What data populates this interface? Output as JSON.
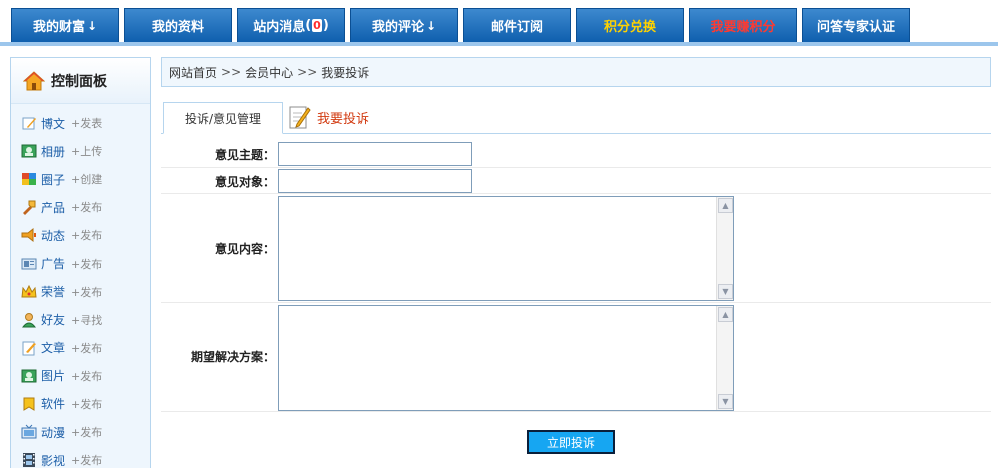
{
  "topnav": {
    "tabs": [
      {
        "label": "我的财富",
        "arrow": "↓",
        "style": "normal"
      },
      {
        "label": "我的资料",
        "arrow": "",
        "style": "normal"
      },
      {
        "label": "站内消息",
        "count": "0",
        "style": "normal"
      },
      {
        "label": "我的评论",
        "arrow": "↓",
        "style": "normal"
      },
      {
        "label": "邮件订阅",
        "arrow": "",
        "style": "normal"
      },
      {
        "label": "积分兑换",
        "arrow": "",
        "style": "gold"
      },
      {
        "label": "我要赚积分",
        "arrow": "",
        "style": "red"
      },
      {
        "label": "问答专家认证",
        "arrow": "",
        "style": "normal"
      }
    ]
  },
  "sidebar": {
    "title": "控制面板",
    "items": [
      {
        "name": "博文",
        "action": "+发表",
        "icon": "blog-icon"
      },
      {
        "name": "相册",
        "action": "+上传",
        "icon": "album-icon"
      },
      {
        "name": "圈子",
        "action": "+创建",
        "icon": "circle-icon"
      },
      {
        "name": "产品",
        "action": "+发布",
        "icon": "product-icon"
      },
      {
        "name": "动态",
        "action": "+发布",
        "icon": "news-icon"
      },
      {
        "name": "广告",
        "action": "+发布",
        "icon": "ad-icon"
      },
      {
        "name": "荣誉",
        "action": "+发布",
        "icon": "crown-icon"
      },
      {
        "name": "好友",
        "action": "+寻找",
        "icon": "friend-icon"
      },
      {
        "name": "文章",
        "action": "+发布",
        "icon": "article-icon"
      },
      {
        "name": "图片",
        "action": "+发布",
        "icon": "picture-icon"
      },
      {
        "name": "软件",
        "action": "+发布",
        "icon": "software-icon"
      },
      {
        "name": "动漫",
        "action": "+发布",
        "icon": "anime-icon"
      },
      {
        "name": "影视",
        "action": "+发布",
        "icon": "film-icon"
      }
    ]
  },
  "breadcrumb": {
    "items": [
      "网站首页",
      "会员中心",
      "我要投诉"
    ],
    "separator": ">>"
  },
  "tabs": {
    "active": "投诉/意见管理",
    "link": "我要投诉"
  },
  "form": {
    "subject_label": "意见主题：",
    "subject_value": "",
    "target_label": "意见对象：",
    "target_value": "",
    "content_label": "意见内容：",
    "content_value": "",
    "solution_label": "期望解决方案：",
    "solution_value": "",
    "submit_label": "立即投诉"
  },
  "colors": {
    "nav_blue": "#1a6fbf",
    "gold": "#ffd200",
    "red": "#ff3a30",
    "link_blue": "#1d5fa8",
    "submit_blue": "#16a6f2"
  }
}
